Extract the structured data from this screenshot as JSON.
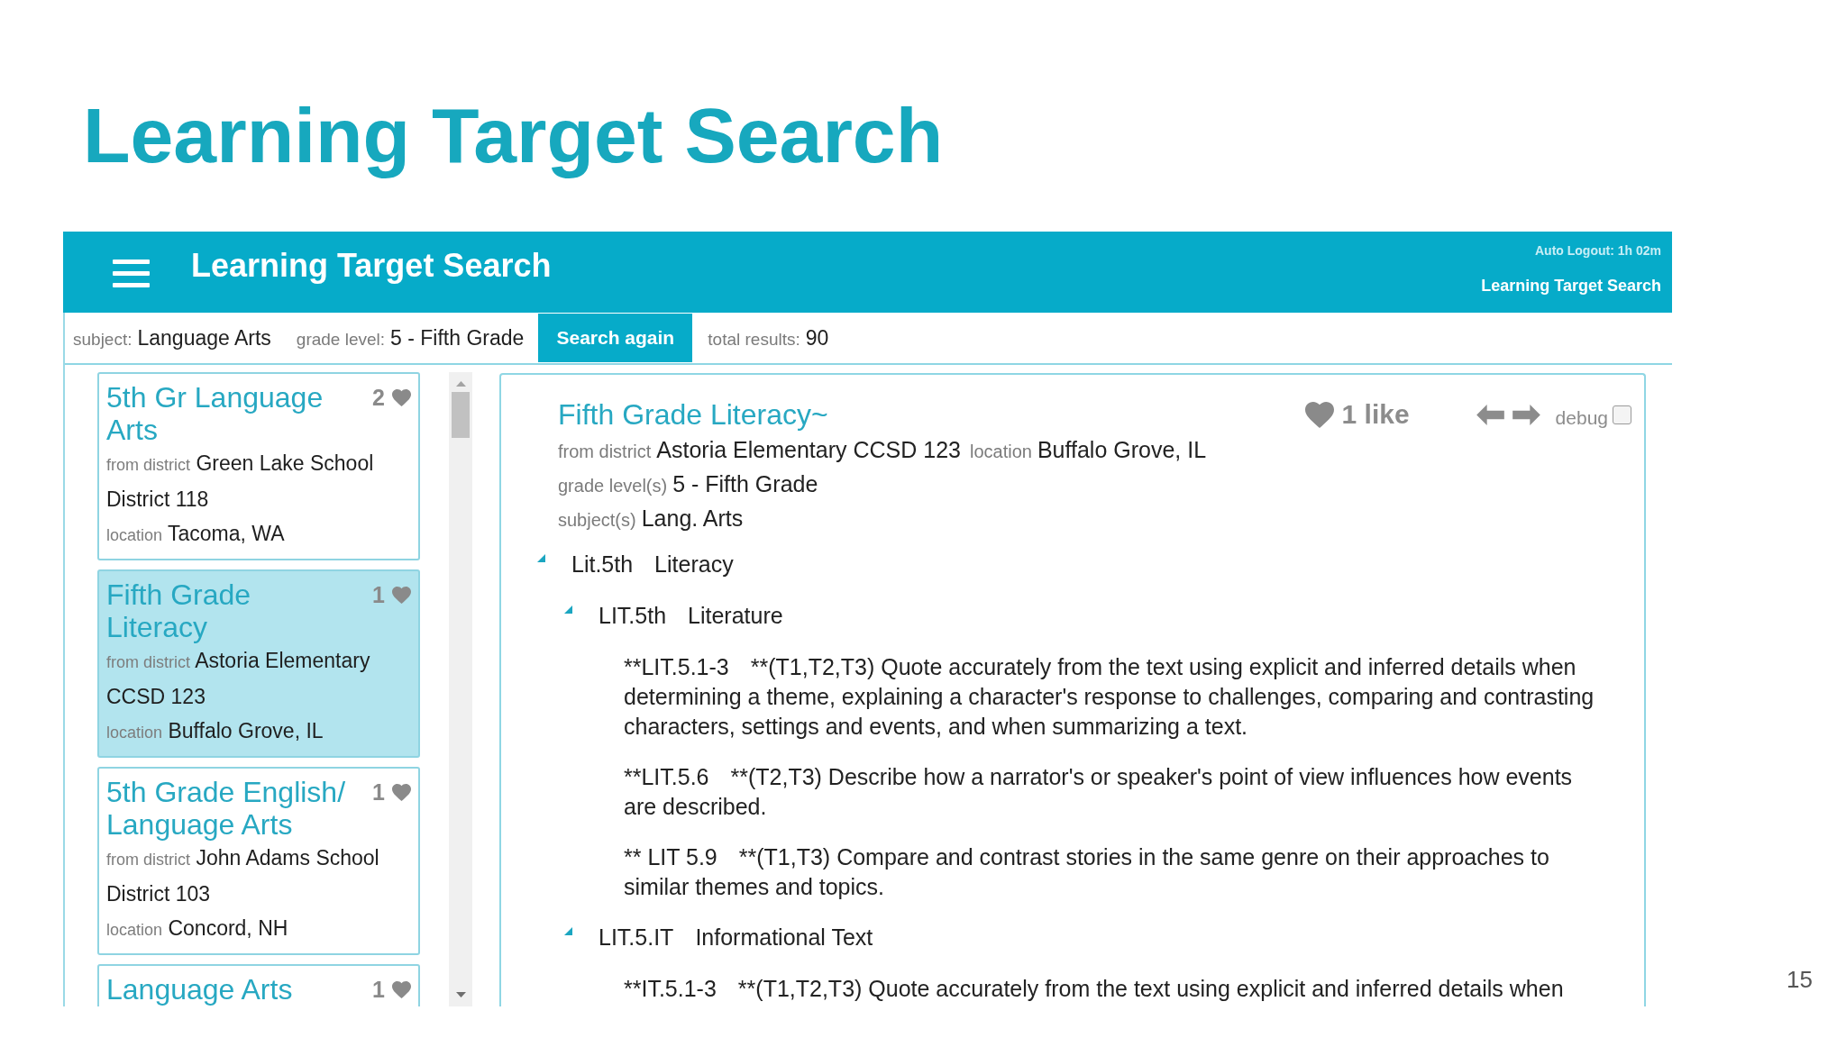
{
  "slide": {
    "title": "Learning Target Search",
    "page_number": "15"
  },
  "app": {
    "header": {
      "title": "Learning Target Search",
      "auto_logout": "Auto Logout: 1h 02m",
      "page_name": "Learning Target Search"
    },
    "search_bar": {
      "fields": [
        {
          "label": "subject:",
          "value": "Language Arts"
        },
        {
          "label": "grade level:",
          "value": "5 - Fifth Grade"
        }
      ],
      "button": "Search again",
      "total_label": "total results:",
      "total_value": "90"
    },
    "results": [
      {
        "title": "5th Gr Language Arts",
        "likes": "2",
        "district_label": "from district",
        "district": "Green Lake School District 118",
        "location_label": "location",
        "location": "Tacoma, WA",
        "selected": false
      },
      {
        "title": "Fifth Grade Literacy",
        "likes": "1",
        "district_label": "from district",
        "district": "Astoria Elementary CCSD 123",
        "location_label": "location",
        "location": "Buffalo Grove, IL",
        "selected": true
      },
      {
        "title": "5th Grade English/ Language Arts",
        "likes": "1",
        "district_label": "from district",
        "district": "John Adams School District 103",
        "location_label": "location",
        "location": "Concord, NH",
        "selected": false
      },
      {
        "title": "Language Arts",
        "likes": "1",
        "selected": false
      }
    ],
    "detail": {
      "title": "Fifth Grade Literacy~",
      "likes": "1 like",
      "debug": {
        "label": "debug",
        "checked": false
      },
      "meta_lines": [
        {
          "fields": [
            {
              "label": "from district",
              "value": "Astoria Elementary CCSD 123"
            },
            {
              "label": "location",
              "value": "Buffalo Grove, IL"
            }
          ]
        },
        {
          "fields": [
            {
              "label": "grade level(s)",
              "value": "5 - Fifth Grade"
            }
          ]
        },
        {
          "fields": [
            {
              "label": "subject(s)",
              "value": "Lang. Arts"
            }
          ]
        }
      ],
      "outline": [
        {
          "kind": "group",
          "code": "Lit.5th",
          "title": "Literacy",
          "expanded": true,
          "children": [
            {
              "kind": "group",
              "code": "LIT.5th",
              "title": "Literature",
              "expanded": true,
              "children": [
                {
                  "kind": "target",
                  "code": "**LIT.5.1-3",
                  "text": "**(T1,T2,T3) Quote accurately from the text using explicit and inferred details when determining a theme, explaining a character's response to challenges, comparing and contrasting characters, settings and events, and when summarizing a text."
                },
                {
                  "kind": "target",
                  "code": "**LIT.5.6",
                  "text": "**(T2,T3) Describe how a narrator's or speaker's point of view influences how events are described."
                },
                {
                  "kind": "target",
                  "code": "** LIT 5.9",
                  "text": "**(T1,T3) Compare and contrast stories in the same genre on their approaches to similar themes and topics."
                }
              ]
            },
            {
              "kind": "group",
              "code": "LIT.5.IT",
              "title": "Informational Text",
              "expanded": true,
              "children": [
                {
                  "kind": "target",
                  "code": "**IT.5.1-3",
                  "text": "**(T1,T2,T3) Quote accurately from the text using explicit and inferred details when"
                }
              ]
            }
          ]
        }
      ]
    }
  }
}
